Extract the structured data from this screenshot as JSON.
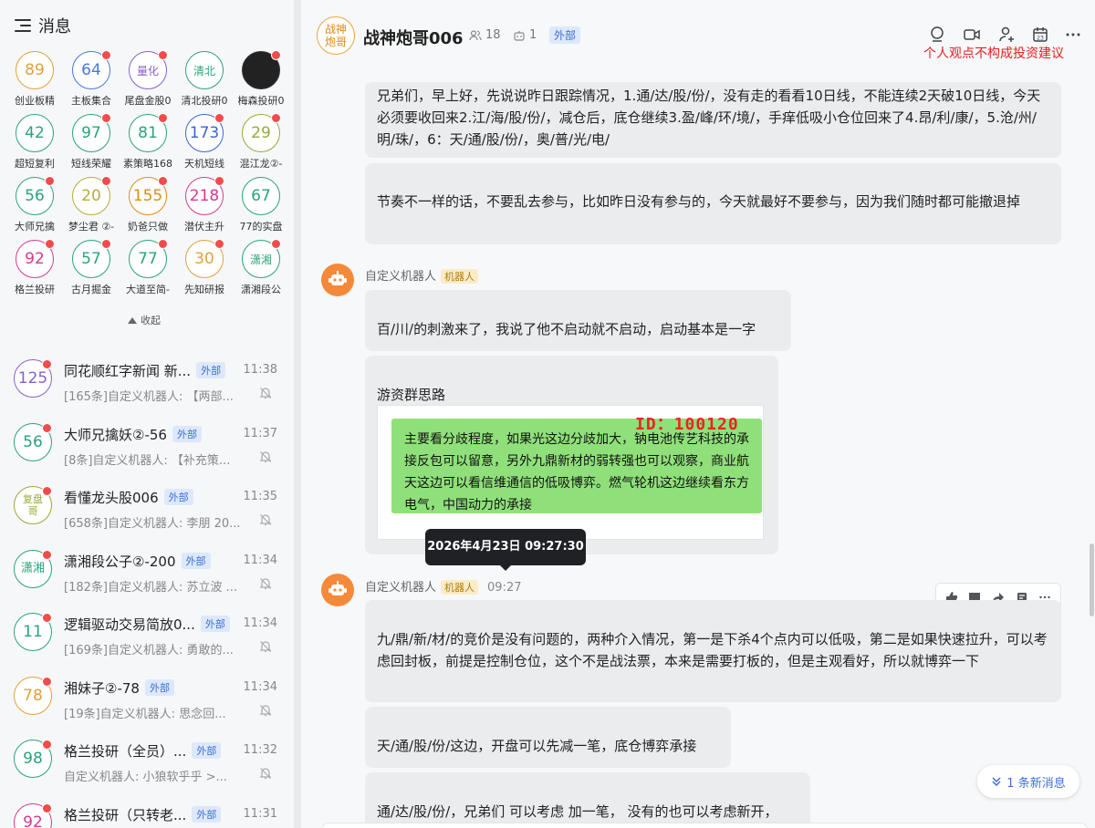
{
  "left": {
    "title": "消息",
    "grid": [
      {
        "text": "89",
        "label": "创业板精",
        "color": "#e0a13a",
        "badge": false
      },
      {
        "text": "64",
        "label": "主板集合",
        "color": "#4a78d8",
        "badge": true
      },
      {
        "text": "量化",
        "label": "尾盘金股0",
        "color": "#8a5fd0",
        "badge": true
      },
      {
        "text": "清北",
        "label": "清北投研0",
        "color": "#2aa37a",
        "badge": false
      },
      {
        "text": "",
        "label": "梅森投研0",
        "color": "#333333",
        "badge": true,
        "dark": true
      },
      {
        "text": "42",
        "label": "超短复利",
        "color": "#2aa37a",
        "badge": false
      },
      {
        "text": "97",
        "label": "短线荣耀",
        "color": "#2aa37a",
        "badge": true
      },
      {
        "text": "81",
        "label": "素策略168",
        "color": "#2aa37a",
        "badge": true
      },
      {
        "text": "173",
        "label": "天机短线",
        "color": "#3a64cf",
        "badge": true
      },
      {
        "text": "29",
        "label": "混江龙②-",
        "color": "#9aa83a",
        "badge": true
      },
      {
        "text": "56",
        "label": "大师兄擒",
        "color": "#2aa37a",
        "badge": true
      },
      {
        "text": "20",
        "label": "梦尘君 ②-",
        "color": "#b7ad3a",
        "badge": true
      },
      {
        "text": "155",
        "label": "奶爸只做",
        "color": "#e08a16",
        "badge": true
      },
      {
        "text": "218",
        "label": "潜伏主升",
        "color": "#d43a8e",
        "badge": true
      },
      {
        "text": "67",
        "label": "77的实盘",
        "color": "#2aa37a",
        "badge": false
      },
      {
        "text": "92",
        "label": "格兰投研",
        "color": "#d43a8e",
        "badge": true
      },
      {
        "text": "57",
        "label": "古月掘金",
        "color": "#2aa37a",
        "badge": true
      },
      {
        "text": "77",
        "label": "大道至简-",
        "color": "#2aa37a",
        "badge": true
      },
      {
        "text": "30",
        "label": "先知研报",
        "color": "#e0a13a",
        "badge": true
      },
      {
        "text": "潇湘",
        "label": "潇湘段公",
        "color": "#2aa37a",
        "badge": true
      }
    ],
    "collapse_label": "收起",
    "chats": [
      {
        "avatar": "125",
        "avatar_color": "#8a5fd0",
        "name": "同花顺红字新闻 新...",
        "tag": "外部",
        "time": "11:38",
        "preview": "[165条]自定义机器人: 【两部...",
        "muted": true
      },
      {
        "avatar": "56",
        "avatar_color": "#2aa37a",
        "name": "大师兄擒妖②-56",
        "tag": "外部",
        "time": "11:37",
        "preview": "[8条]自定义机器人: 【补充策...",
        "muted": true
      },
      {
        "avatar": "复盘哥",
        "avatar_color": "#9aa83a",
        "name": "看懂龙头股006",
        "tag": "外部",
        "time": "11:35",
        "preview": "[658条]自定义机器人: 李朋 20...",
        "muted": true
      },
      {
        "avatar": "潇湘",
        "avatar_color": "#2aa37a",
        "name": "潇湘段公子②-200",
        "tag": "外部",
        "time": "11:34",
        "preview": "[182条]自定义机器人: 苏立波 ...",
        "muted": true
      },
      {
        "avatar": "11",
        "avatar_color": "#2aa37a",
        "name": "逻辑驱动交易简放0...",
        "tag": "外部",
        "time": "11:34",
        "preview": "[169条]自定义机器人: 勇敢的...",
        "muted": true
      },
      {
        "avatar": "78",
        "avatar_color": "#e0a13a",
        "name": "湘妹子②-78",
        "tag": "外部",
        "time": "11:34",
        "preview": "[19条]自定义机器人: 思念回...",
        "muted": true
      },
      {
        "avatar": "98",
        "avatar_color": "#2aa37a",
        "name": "格兰投研（全员）...",
        "tag": "外部",
        "time": "11:32",
        "preview": "自定义机器人: 小狼软乎乎 >...",
        "muted": true
      },
      {
        "avatar": "92",
        "avatar_color": "#d43a8e",
        "name": "格兰投研（只转老...",
        "tag": "外部",
        "time": "11:31",
        "preview": "",
        "muted": false
      }
    ]
  },
  "chat": {
    "avatar_text": "战神炮哥",
    "title": "战神炮哥006",
    "members": "18",
    "bots": "1",
    "tag": "外部",
    "disclaimer": "个人观点不构成投资建议",
    "msg1": "兄弟们，早上好，先说说昨日跟踪情况，1.通/达/股/份/，没有走的看看10日线，不能连续2天破10日线，今天必须要收回来2.江/海/股/份/，减仓后，底仓继续3.盈/峰/环/境/，手痒低吸小仓位回来了4.昂/利/康/，5.沧/州/明/珠/，6：天/通/股/份/，奥/普/光/电/",
    "msg2": "节奏不一样的话，不要乱去参与，比如昨日没有参与的，今天就最好不要参与，因为我们随时都可能撤退掉",
    "bot_name": "自定义机器人",
    "bot_tag": "机器人",
    "msg3": "百/川/的刺激来了，我说了他不启动就不启动，启动基本是一字",
    "msg4_title": "游资群思路",
    "img_id": "ID：100120",
    "img_text": "主要看分歧程度，如果光这边分歧加大，钠电池传艺科技的承接反包可以留意，另外九鼎新材的弱转强也可以观察，商业航天这边可以看信维通信的低吸博弈。燃气轮机这边继续看东方电气，中国动力的承接",
    "tooltip": "2026年4月23日 09:27:30",
    "time2": "09:27",
    "msg5": "九/鼎/新/材/的竞价是没有问题的，两种介入情况，第一是下杀4个点内可以低吸，第二是如果快速拉升，可以考虑回封板，前提是控制仓位，这个不是战法票，本来是需要打板的，但是主观看好，所以就博弈一下",
    "msg6": "天/通/股/份/这边，开盘可以先减一笔，底仓博弈承接",
    "msg7": "通/达/股/份/，兄弟们 可以考虑 加一笔， 没有的也可以考虑新开，",
    "new_messages": "1 条新消息"
  }
}
